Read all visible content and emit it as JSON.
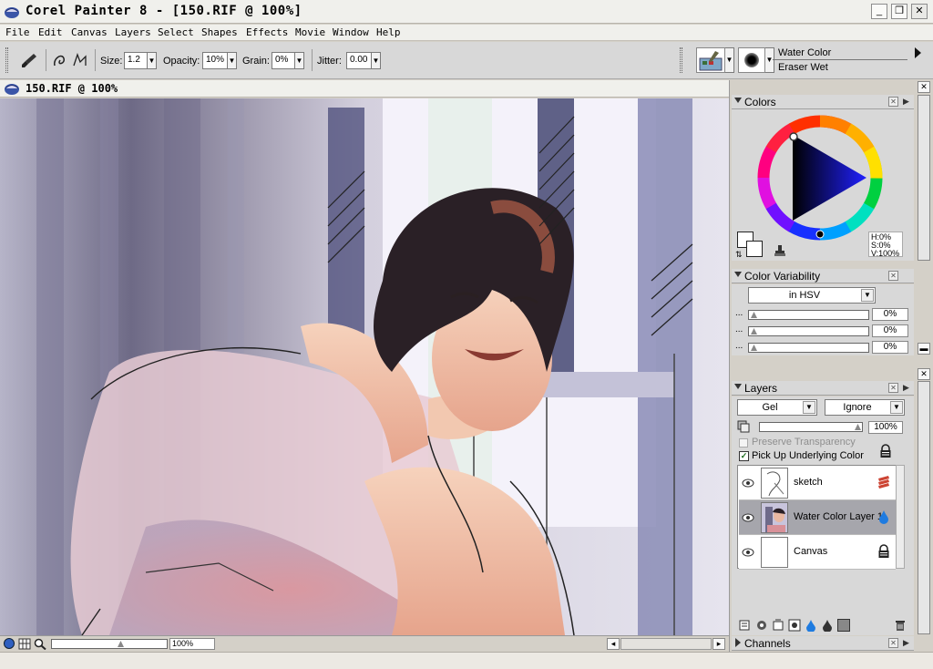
{
  "titlebar": {
    "title": "Corel Painter 8 - [150.RIF @ 100%]",
    "min": "_",
    "restore": "❐",
    "close": "✕"
  },
  "menu": [
    "File",
    "Edit",
    "Canvas",
    "Layers",
    "Select",
    "Shapes",
    "Effects",
    "Movie",
    "Window",
    "Help"
  ],
  "propbar": {
    "size_label": "Size:",
    "size_value": "1.2",
    "opacity_label": "Opacity:",
    "opacity_value": "10%",
    "grain_label": "Grain:",
    "grain_value": "0%",
    "jitter_label": "Jitter:",
    "jitter_value": "0.00",
    "brush_category": "Water Color",
    "brush_variant": "Eraser Wet"
  },
  "document": {
    "title": "150.RIF @ 100%",
    "zoom": "100%"
  },
  "colors": {
    "title": "Colors",
    "hsv": "H:0%\nS:0%\nV:100%",
    "h": "H:0%",
    "s": "S:0%",
    "v": "V:100%"
  },
  "variability": {
    "title": "Color Variability",
    "mode": "in HSV",
    "values": [
      "0%",
      "0%",
      "0%"
    ],
    "dots": "..."
  },
  "layers": {
    "title": "Layers",
    "composite_method": "Gel",
    "composite_depth": "Ignore",
    "opacity": "100%",
    "preserve_transparency": "Preserve Transparency",
    "pick_up_color": "Pick Up Underlying Color",
    "items": [
      {
        "name": "sketch",
        "selected": false
      },
      {
        "name": "Water Color Layer 1",
        "selected": true
      },
      {
        "name": "Canvas",
        "selected": false
      }
    ]
  },
  "channels": {
    "title": "Channels"
  },
  "icons": {
    "app": "painter-logo-icon",
    "brush": "brush-icon",
    "eye": "eye-icon",
    "lock": "lock-icon",
    "trash": "trash-icon",
    "stamp": "stamp-icon",
    "swap": "swap-colors-icon"
  },
  "colors_palette": {
    "accent_select": "#a6a6ac",
    "panel_bg": "#d4d0c8"
  }
}
